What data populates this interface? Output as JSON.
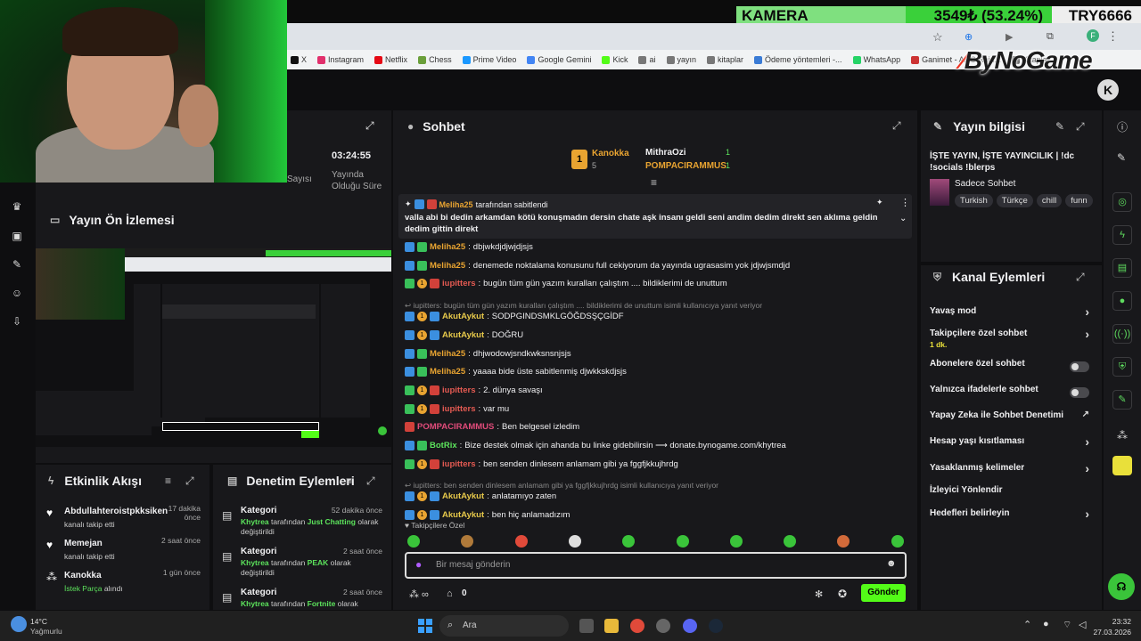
{
  "ticker": {
    "name": "KAMERA",
    "price": "3549₺ (53.24%)",
    "code": "TRY6666"
  },
  "bookmarks": [
    {
      "label": "X"
    },
    {
      "label": "Instagram"
    },
    {
      "label": "Netflix"
    },
    {
      "label": "Chess"
    },
    {
      "label": "Prime Video"
    },
    {
      "label": "Google Gemini"
    },
    {
      "label": "Kick"
    },
    {
      "label": "ai"
    },
    {
      "label": "yayın"
    },
    {
      "label": "kitaplar"
    },
    {
      "label": "Ödeme yöntemleri -..."
    },
    {
      "label": "WhatsApp"
    },
    {
      "label": "Ganimet - ARC Raid..."
    },
    {
      "label": "Kitaplar"
    }
  ],
  "logo": {
    "text": "ByNoGame"
  },
  "stats": {
    "viewers_label": "Sayısı",
    "uptime": "03:24:55",
    "uptime_label": "Yayında Olduğu Süre"
  },
  "preview": {
    "title": "Yayın Ön İzlemesi"
  },
  "activity": {
    "title": "Etkinlik Akışı",
    "items": [
      {
        "user": "Abdullahteroistpkksiken",
        "time": "17 dakika önce",
        "action": "kanalı takip etti"
      },
      {
        "user": "Memejan",
        "time": "2 saat önce",
        "action": "kanalı takip etti"
      },
      {
        "user": "Kanokka",
        "time": "1 gün önce",
        "action_highlight": "İstek Parça",
        "action": "alındı"
      }
    ]
  },
  "moderation": {
    "title": "Denetim Eylemleri",
    "items": [
      {
        "label": "Kategori",
        "time": "52 dakika önce",
        "actor": "Khytrea",
        "mid": "tarafından",
        "value": "Just Chatting",
        "suffix": "olarak değiştirildi"
      },
      {
        "label": "Kategori",
        "time": "2 saat önce",
        "actor": "Khytrea",
        "mid": "tarafından",
        "value": "PEAK",
        "suffix": "olarak değiştirildi"
      },
      {
        "label": "Kategori",
        "time": "2 saat önce",
        "actor": "Khytrea",
        "mid": "tarafından",
        "value": "Fortnite",
        "suffix": "olarak"
      }
    ]
  },
  "chat": {
    "title": "Sohbet",
    "leaderboard": {
      "first_name": "Kanokka",
      "first_count": "5",
      "rank": "1",
      "second_name": "MithraOzi",
      "second_count": "1",
      "third_name": "POMPACIRAMMUS",
      "third_count": "1"
    },
    "pinned": {
      "by": "Meliha25",
      "by_suffix": "tarafından sabitlendi",
      "text": "valla abi bi dedin arkamdan kötü konuşmadın dersin chate aşk insanı geldi seni andim dedim direkt sen aklıma geldin dedim gittin direkt"
    },
    "messages": [
      {
        "user": "Meliha25",
        "text": "dbjwkdjdjwjdjsjs"
      },
      {
        "user": "Meliha25",
        "text": "denemede noktalama konusunu full cekiyorum da yayında ugrasasim yok jdjwjsmdjd"
      },
      {
        "user": "iupitters",
        "text": "bugün tüm gün yazım kuralları çalıştım .... bildiklerimi de unuttum"
      },
      {
        "reply": "iupitters: bugün tüm gün yazım kuralları çalıştım .... bildiklerimi de unuttum isimli kullanıcıya yanıt veriyor"
      },
      {
        "user": "AkutAykut",
        "text": "SODPGINDSMKLGÖĞDSŞÇGİDF"
      },
      {
        "user": "AkutAykut",
        "text": "DOĞRU"
      },
      {
        "user": "Meliha25",
        "text": "dhjwodowjsndkwksnsnjsjs"
      },
      {
        "user": "Meliha25",
        "text": "yaaaa bide üste sabitlenmiş djwkkskdjsjs"
      },
      {
        "user": "iupitters",
        "text": "2. dünya savaşı"
      },
      {
        "user": "iupitters",
        "text": "var mu"
      },
      {
        "user": "POMPACIRAMMUS",
        "text": "Ben belgesel izledim"
      },
      {
        "user": "BotRix",
        "text": "Bize destek olmak için ahanda bu linke gidebilirsin ⟶ donate.bynogame.com/khytrea"
      },
      {
        "user": "iupitters",
        "text": "ben senden dinlesem anlamam gibi ya fggfjkkujhrdg"
      },
      {
        "reply": "iupitters: ben senden dinlesem anlamam gibi ya fggfjkkujhrdg isimli kullanıcıya yanıt veriyor"
      },
      {
        "user": "AkutAykut",
        "text": "anlatamıyo zaten"
      },
      {
        "user": "AkutAykut",
        "text": "ben hiç anlamadızım"
      }
    ],
    "followers_only": "Takipçilere Özel",
    "input_placeholder": "Bir mesaj gönderin",
    "points": "0",
    "send": "Gönder"
  },
  "stream_info": {
    "title": "Yayın bilgisi",
    "stream_title": "İŞTE YAYIN, İŞTE YAYINCILIK | !dc !socials !blerps",
    "category": "Sadece Sohbet",
    "tags": [
      "Turkish",
      "Türkçe",
      "chill",
      "funn"
    ]
  },
  "channel_actions": {
    "title": "Kanal Eylemleri",
    "items": [
      {
        "label": "Yavaş mod",
        "control": "chevron"
      },
      {
        "label": "Takipçilere özel sohbet",
        "sub": "1 dk.",
        "control": "chevron"
      },
      {
        "label": "Abonelere özel sohbet",
        "control": "toggle",
        "on": false
      },
      {
        "label": "Yalnızca ifadelerle sohbet",
        "control": "toggle",
        "on": false
      },
      {
        "label": "Yapay Zeka ile Sohbet Denetimi",
        "control": "external"
      },
      {
        "label": "Hesap yaşı kısıtlaması",
        "control": "chevron"
      },
      {
        "label": "Yasaklanmış kelimeler",
        "control": "chevron"
      },
      {
        "label": "İzleyici Yönlendir",
        "control": "none"
      },
      {
        "label": "Hedefleri belirleyin",
        "control": "chevron"
      }
    ]
  },
  "taskbar": {
    "weather_temp": "14°C",
    "weather_desc": "Yağmurlu",
    "search": "Ara",
    "time": "23:32",
    "date": "27.03.2026"
  },
  "colors": {
    "accent": "#53fc18",
    "bg": "#0e0e10",
    "panel": "#18181b"
  }
}
